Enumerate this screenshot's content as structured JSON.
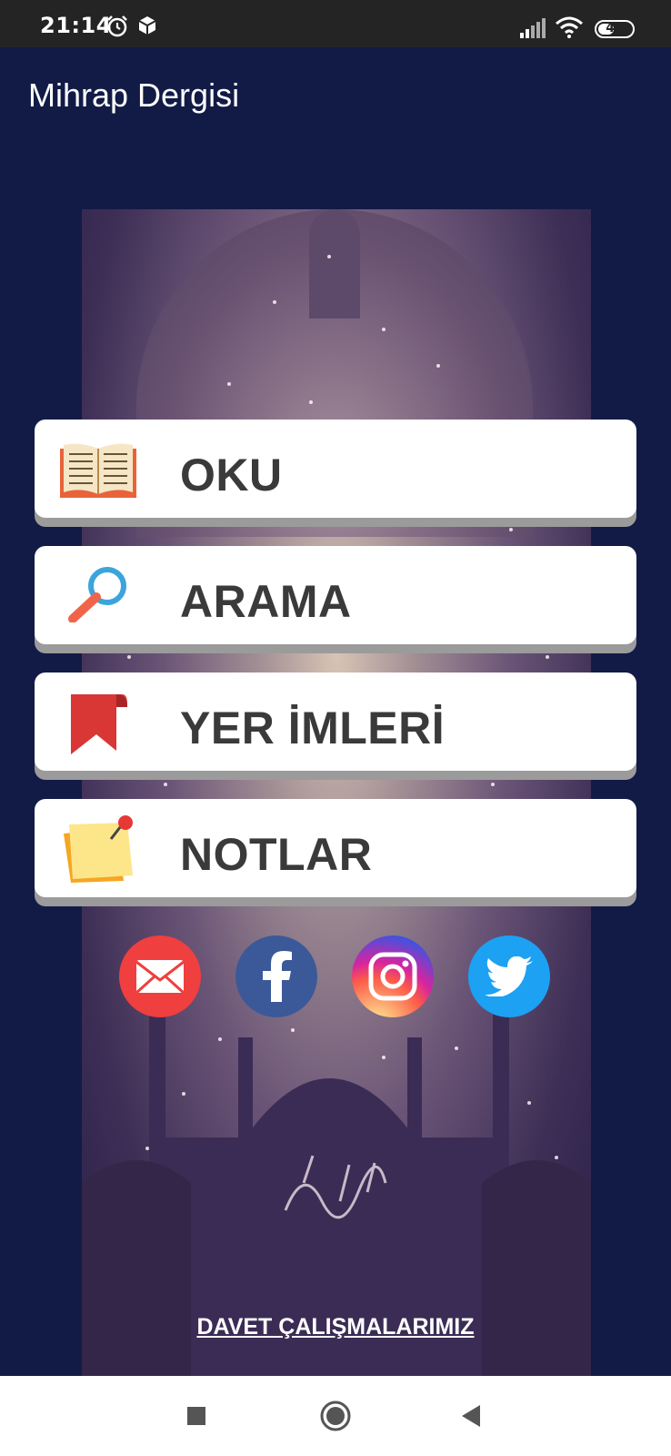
{
  "status_bar": {
    "time": "21:14",
    "icons_left": [
      "alarm-icon",
      "box-icon"
    ],
    "icons_right": [
      "signal-icon",
      "wifi-icon"
    ],
    "battery": 47
  },
  "app_bar": {
    "title": "Mihrap Dergisi"
  },
  "menu": [
    {
      "label": "OKU",
      "icon": "open-book-icon"
    },
    {
      "label": "ARAMA",
      "icon": "magnifier-icon"
    },
    {
      "label": "YER İMLERİ",
      "icon": "bookmark-icon"
    },
    {
      "label": "NOTLAR",
      "icon": "sticky-note-icon"
    }
  ],
  "social": [
    {
      "name": "email",
      "color": "#ef3f3f"
    },
    {
      "name": "facebook",
      "color": "#3b5998"
    },
    {
      "name": "instagram",
      "color": "#c13584"
    },
    {
      "name": "twitter",
      "color": "#1da1f2"
    }
  ],
  "footer": {
    "link": "DAVET ÇALIŞMALARIMIZ"
  },
  "nav": [
    "recents-button",
    "home-button",
    "back-button"
  ]
}
